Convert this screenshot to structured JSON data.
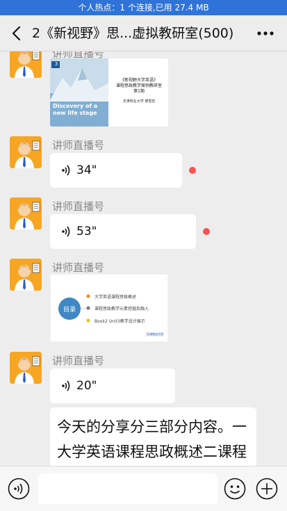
{
  "status_bar": {
    "hotspot_text": "个人热点：1 个连接,已用 27.4 MB"
  },
  "header": {
    "title": "2《新视野》思...虚拟教研室(500)"
  },
  "messages": [
    {
      "type": "image",
      "sender": "讲师直播号",
      "slide": {
        "badge": "3",
        "title_line1": "《新视野大学英语》",
        "title_line2": "课程思政教学案例教研室",
        "title_line3": "第1期",
        "author": "天津商业大学  德雪岩",
        "banner_text": "Discovery of a new life stage"
      }
    },
    {
      "type": "voice",
      "sender": "讲师直播号",
      "duration": "34\"",
      "unread": true
    },
    {
      "type": "voice",
      "sender": "讲师直播号",
      "duration": "53\"",
      "unread": true
    },
    {
      "type": "image",
      "sender": "讲师直播号",
      "slide": {
        "toc_label": "目录",
        "items": [
          "大学英语课程思政概述",
          "课程思政教学元素挖掘及融入",
          "Book2 Unit3教学设计展示"
        ],
        "logo_text": "天津商业大学"
      }
    },
    {
      "type": "voice",
      "sender": "讲师直播号",
      "duration": "20\"",
      "unread": false
    },
    {
      "type": "text",
      "text": "今天的分享分三部分内容。一大学英语课程思政概述二课程思政教学元素挖掘及融入 三"
    }
  ],
  "colors": {
    "hotspot_bar": "#2f73d8",
    "unread_dot": "#fa5151",
    "avatar_bg": "#f7a623"
  }
}
